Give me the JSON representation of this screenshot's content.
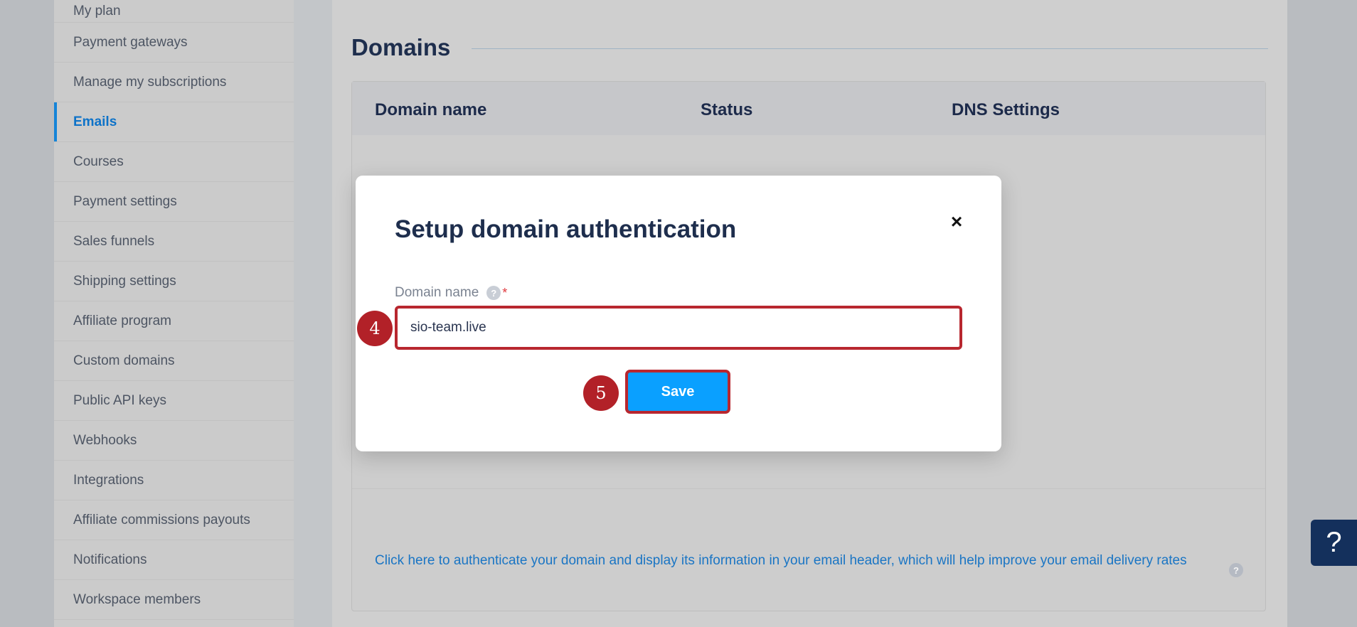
{
  "sidebar": {
    "items": [
      {
        "label": "My plan"
      },
      {
        "label": "Payment gateways"
      },
      {
        "label": "Manage my subscriptions"
      },
      {
        "label": "Emails",
        "active": true
      },
      {
        "label": "Courses"
      },
      {
        "label": "Payment settings"
      },
      {
        "label": "Sales funnels"
      },
      {
        "label": "Shipping settings"
      },
      {
        "label": "Affiliate program"
      },
      {
        "label": "Custom domains"
      },
      {
        "label": "Public API keys"
      },
      {
        "label": "Webhooks"
      },
      {
        "label": "Integrations"
      },
      {
        "label": "Affiliate commissions payouts"
      },
      {
        "label": "Notifications"
      },
      {
        "label": "Workspace members"
      }
    ]
  },
  "main": {
    "section_title": "Domains",
    "table": {
      "columns": [
        "Domain name",
        "Status",
        "DNS Settings"
      ]
    },
    "auth_link": "Click here to authenticate your domain and display its information in your email header, which will help improve your email delivery rates",
    "help_icon": "question-icon"
  },
  "help_fab": {
    "glyph": "?"
  },
  "modal": {
    "title": "Setup domain authentication",
    "close_glyph": "×",
    "field_label": "Domain name",
    "field_help_glyph": "?",
    "required_marker": "*",
    "field_value": "sio-team.live",
    "save_label": "Save"
  },
  "annotations": {
    "step_4": "4",
    "step_5": "5"
  },
  "colors": {
    "accent": "#0aa0ff",
    "link": "#1a75c4",
    "highlight_border": "#b8272f",
    "badge": "#b22128",
    "title": "#1e2e4d"
  }
}
